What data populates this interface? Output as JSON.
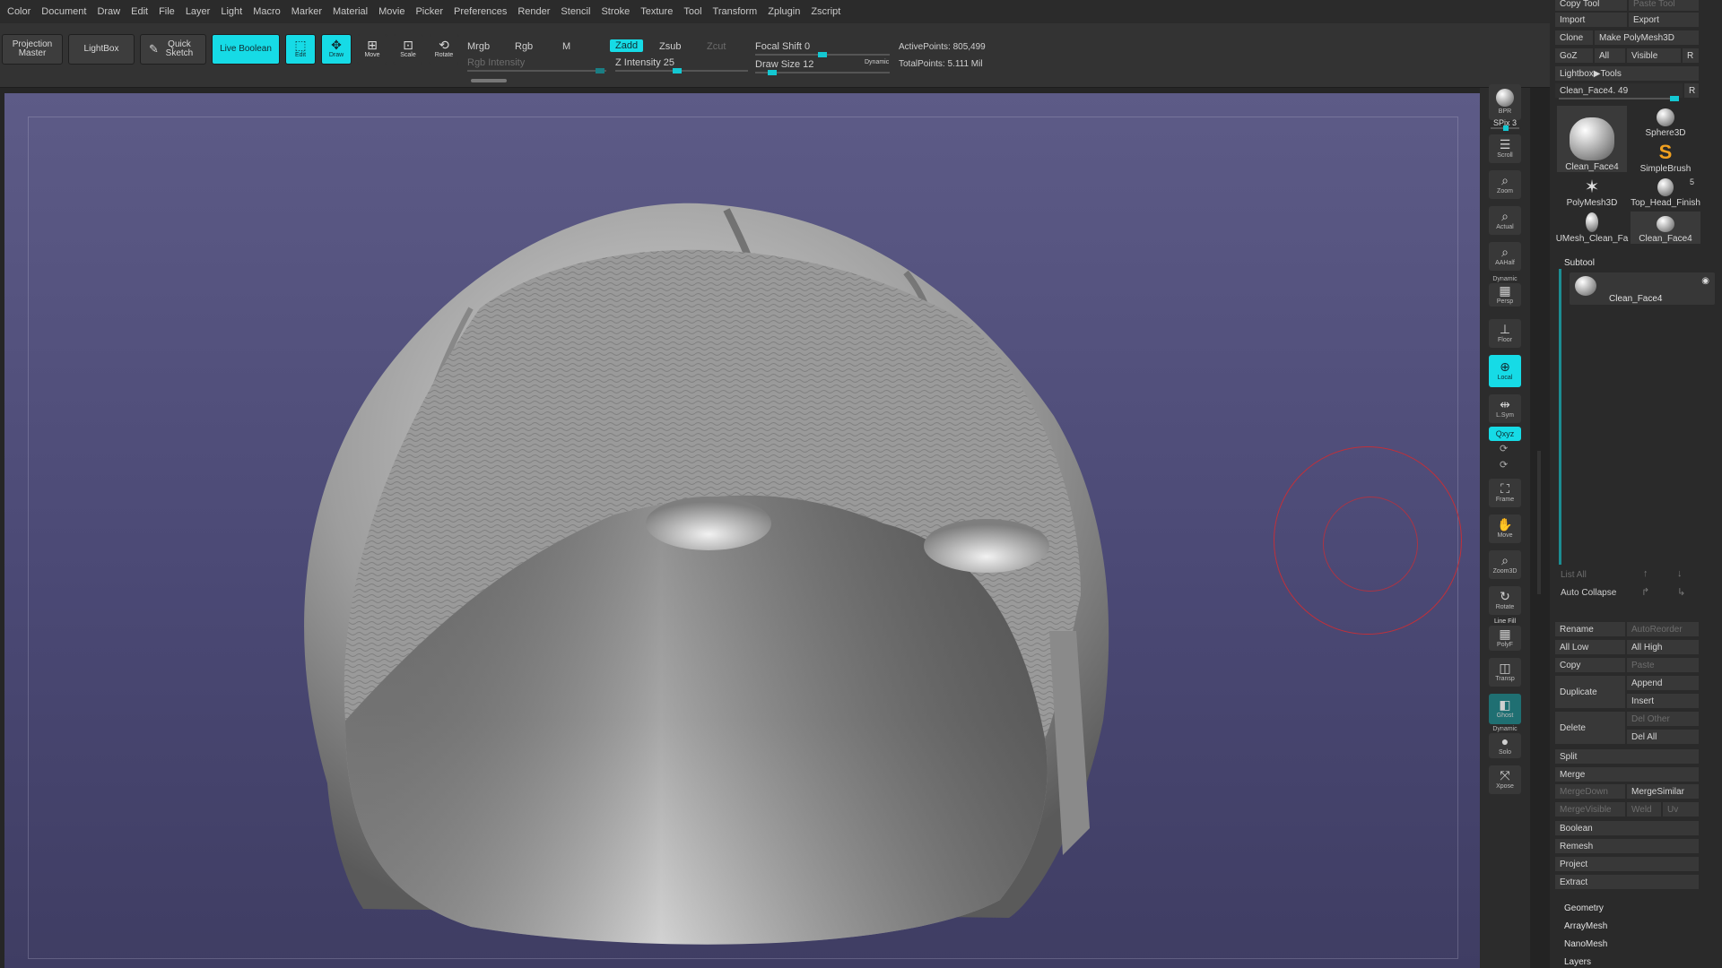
{
  "menu": [
    "Color",
    "Document",
    "Draw",
    "Edit",
    "File",
    "Layer",
    "Light",
    "Macro",
    "Marker",
    "Material",
    "Movie",
    "Picker",
    "Preferences",
    "Render",
    "Stencil",
    "Stroke",
    "Texture",
    "Tool",
    "Transform",
    "Zplugin",
    "Zscript"
  ],
  "toolbar": {
    "projection_master": "Projection Master",
    "lightbox": "LightBox",
    "quick_sketch": "Quick Sketch",
    "live_boolean": "Live Boolean",
    "edit": "Edit",
    "draw": "Draw",
    "move": "Move",
    "scale": "Scale",
    "rotate": "Rotate",
    "mrgb": "Mrgb",
    "rgb": "Rgb",
    "m": "M",
    "rgb_intensity": "Rgb Intensity",
    "zadd": "Zadd",
    "zsub": "Zsub",
    "zcut": "Zcut",
    "z_intensity": "Z Intensity 25",
    "focal_shift": "Focal Shift 0",
    "draw_size": "Draw Size 12",
    "dynamic": "Dynamic",
    "active_points": "ActivePoints: 805,499",
    "total_points": "TotalPoints: 5.111 Mil"
  },
  "strip": {
    "bpr": "BPR",
    "spix": "SPix 3",
    "scroll": "Scroll",
    "zoom": "Zoom",
    "actual": "Actual",
    "aahalf": "AAHalf",
    "dynamic": "Dynamic",
    "persp": "Persp",
    "floor": "Floor",
    "local": "Local",
    "lsym": "L.Sym",
    "qxyz": "Qxyz",
    "frame": "Frame",
    "move": "Move",
    "zoom3d": "Zoom3D",
    "rotate": "Rotate",
    "line_fill": "Line Fill",
    "polyf": "PolyF",
    "transp": "Transp",
    "ghost": "Ghost",
    "solo_dynamic": "Dynamic",
    "solo": "Solo",
    "xpose": "Xpose"
  },
  "panel": {
    "copy_tool": "Copy Tool",
    "paste_tool": "Paste Tool",
    "import": "Import",
    "export": "Export",
    "clone": "Clone",
    "make_polymesh": "Make PolyMesh3D",
    "goz": "GoZ",
    "all": "All",
    "visible": "Visible",
    "r": "R",
    "lightbox_tools": "Lightbox▶Tools",
    "current_tool": "Clean_Face4. 49",
    "tools": [
      {
        "name": "Clean_Face4"
      },
      {
        "name": "Sphere3D"
      },
      {
        "name": "SimpleBrush"
      },
      {
        "name": "PolyMesh3D"
      },
      {
        "name": "Top_Head_Finish"
      },
      {
        "name": "UMesh_Clean_Fa"
      },
      {
        "name": "Clean_Face4"
      }
    ],
    "tool_count": "5",
    "subtool_header": "Subtool",
    "subtool_item": "Clean_Face4",
    "list_all": "List All",
    "auto_collapse": "Auto Collapse",
    "rename": "Rename",
    "autoreorder": "AutoReorder",
    "all_low": "All Low",
    "all_high": "All High",
    "copy": "Copy",
    "paste": "Paste",
    "duplicate": "Duplicate",
    "append": "Append",
    "insert": "Insert",
    "delete": "Delete",
    "del_other": "Del Other",
    "del_all": "Del All",
    "split": "Split",
    "merge": "Merge",
    "merge_down": "MergeDown",
    "merge_similar": "MergeSimilar",
    "merge_visible": "MergeVisible",
    "weld": "Weld",
    "uv": "Uv",
    "boolean": "Boolean",
    "remesh": "Remesh",
    "project": "Project",
    "extract": "Extract",
    "geometry": "Geometry",
    "arraymesh": "ArrayMesh",
    "nanomesh": "NanoMesh",
    "layers": "Layers"
  },
  "colors": {
    "accent": "#16dbe6",
    "viewport_top": "#5d5b87",
    "viewport_bottom": "#3f3d63",
    "brush_ring": "#c0303a"
  }
}
